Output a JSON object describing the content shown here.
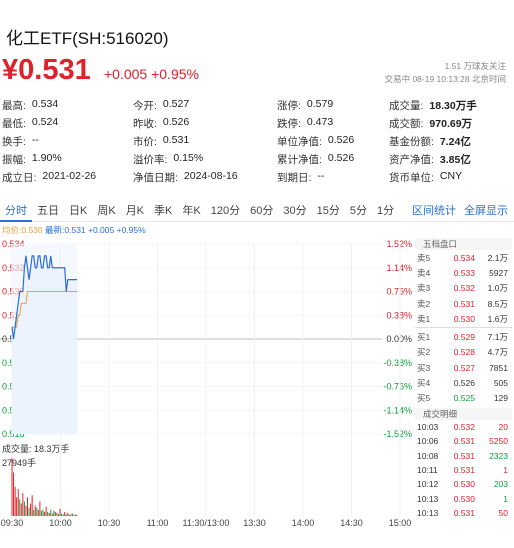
{
  "header": {
    "title": "化工ETF(SH:516020)",
    "price": "¥0.531",
    "change": "+0.005 +0.95%",
    "follow_line1": "1.51 万球友关注",
    "follow_line2": "交易中 08-19 10:13:28 北京时间"
  },
  "quote": [
    [
      {
        "label": "最高:",
        "value": "0.534",
        "tone": "red"
      },
      {
        "label": "今开:",
        "value": "0.527",
        "tone": "red"
      },
      {
        "label": "涨停:",
        "value": "0.579",
        "tone": "red"
      },
      {
        "label": "成交量:",
        "value": "18.30万手",
        "tone": "bold"
      }
    ],
    [
      {
        "label": "最低:",
        "value": "0.524",
        "tone": "green"
      },
      {
        "label": "昨收:",
        "value": "0.526",
        "tone": ""
      },
      {
        "label": "跌停:",
        "value": "0.473",
        "tone": "green"
      },
      {
        "label": "成交额:",
        "value": "970.69万",
        "tone": "bold"
      }
    ],
    [
      {
        "label": "换手:",
        "value": "--",
        "tone": ""
      },
      {
        "label": "市价:",
        "value": "0.531",
        "tone": ""
      },
      {
        "label": "单位净值:",
        "value": "0.526",
        "tone": ""
      },
      {
        "label": "基金份额:",
        "value": "7.24亿",
        "tone": "bold"
      }
    ],
    [
      {
        "label": "振幅:",
        "value": "1.90%",
        "tone": ""
      },
      {
        "label": "溢价率:",
        "value": "0.15%",
        "tone": ""
      },
      {
        "label": "累计净值:",
        "value": "0.526",
        "tone": ""
      },
      {
        "label": "资产净值:",
        "value": "3.85亿",
        "tone": "bold"
      }
    ],
    [
      {
        "label": "成立日:",
        "value": "2021-02-26",
        "tone": ""
      },
      {
        "label": "净值日期:",
        "value": "2024-08-16",
        "tone": ""
      },
      {
        "label": "到期日:",
        "value": "--",
        "tone": ""
      },
      {
        "label": "货币单位:",
        "value": "CNY",
        "tone": ""
      }
    ]
  ],
  "tabs": [
    "分时",
    "五日",
    "日K",
    "周K",
    "月K",
    "季K",
    "年K",
    "120分",
    "60分",
    "30分",
    "15分",
    "5分",
    "1分"
  ],
  "tab_links": [
    "区间统计",
    "全屏显示"
  ],
  "legend": {
    "avg": "均价:0.530",
    "latest": "最新:0.531 +0.005 +0.95%"
  },
  "chart_data": {
    "type": "line",
    "title": "",
    "y_price_ticks": [
      "0.534",
      "0.532",
      "0.530",
      "0.528",
      "0.526",
      "0.524",
      "0.522",
      "0.520",
      "0.518"
    ],
    "y_pct_ticks": [
      "1.52%",
      "1.14%",
      "0.76%",
      "0.38%",
      "0.00%",
      "-0.38%",
      "-0.76%",
      "-1.14%",
      "-1.52%"
    ],
    "x_ticks": [
      "09:30",
      "10:00",
      "10:30",
      "11:00",
      "11:30/13:00",
      "13:30",
      "14:00",
      "14:30",
      "15:00"
    ],
    "ylim": [
      0.518,
      0.534
    ],
    "prev_close": 0.526,
    "price": [
      0.527,
      0.526,
      0.527,
      0.528,
      0.529,
      0.53,
      0.53,
      0.53,
      0.532,
      0.533,
      0.532,
      0.531,
      0.532,
      0.533,
      0.533,
      0.532,
      0.532,
      0.533,
      0.533,
      0.532,
      0.532,
      0.533,
      0.533,
      0.532,
      0.532,
      0.533,
      0.532,
      0.532,
      0.532,
      0.532,
      0.532,
      0.532,
      0.532,
      0.532,
      0.532,
      0.53,
      0.531,
      0.531,
      0.531,
      0.531,
      0.531,
      0.531,
      0.531
    ],
    "avg": [
      0.527,
      0.527,
      0.527,
      0.527,
      0.528,
      0.528,
      0.529,
      0.529,
      0.529,
      0.529,
      0.53,
      0.53,
      0.53,
      0.53,
      0.53,
      0.53,
      0.53,
      0.53,
      0.53,
      0.53,
      0.53,
      0.53,
      0.53,
      0.53,
      0.53,
      0.53,
      0.53,
      0.53,
      0.53,
      0.53,
      0.53,
      0.53,
      0.53,
      0.53,
      0.53,
      0.53,
      0.53,
      0.53,
      0.53,
      0.53,
      0.53,
      0.53,
      0.53
    ],
    "volume_label": "成交量: 18.3万手",
    "volume_max_label": "27949手",
    "volume_max": 27949,
    "volume": [
      27949,
      21000,
      14000,
      9000,
      13000,
      8000,
      6000,
      11000,
      7000,
      5000,
      9000,
      4000,
      6000,
      10000,
      3000,
      5000,
      4000,
      3000,
      7000,
      2500,
      3000,
      2000,
      4500,
      2000,
      1500,
      3000,
      1200,
      2500,
      2000,
      1500,
      900,
      3500,
      1200,
      800,
      2000,
      800,
      1500,
      600,
      900,
      1200,
      500,
      700,
      400
    ],
    "volume_up": [
      1,
      1,
      1,
      1,
      1,
      0,
      1,
      1,
      0,
      1,
      1,
      0,
      1,
      1,
      0,
      1,
      0,
      1,
      1,
      0,
      0,
      1,
      1,
      0,
      1,
      0,
      0,
      1,
      0,
      1,
      0,
      1,
      0,
      0,
      1,
      0,
      1,
      0,
      1,
      0,
      0,
      1,
      1
    ]
  },
  "order_book": {
    "title": "五档盘口",
    "asks": [
      [
        "卖5",
        "0.534",
        "2.1万"
      ],
      [
        "卖4",
        "0.533",
        "5927"
      ],
      [
        "卖3",
        "0.532",
        "1.0万"
      ],
      [
        "卖2",
        "0.531",
        "8.5万"
      ],
      [
        "卖1",
        "0.530",
        "1.6万"
      ]
    ],
    "bids": [
      [
        "买1",
        "0.529",
        "7.1万"
      ],
      [
        "买2",
        "0.528",
        "4.7万"
      ],
      [
        "买3",
        "0.527",
        "7851"
      ],
      [
        "买4",
        "0.526",
        "505"
      ],
      [
        "买5",
        "0.525",
        "129"
      ]
    ]
  },
  "trades": {
    "title": "成交明细",
    "rows": [
      [
        "10:03",
        "0.532",
        "20",
        "red"
      ],
      [
        "10:06",
        "0.531",
        "5250",
        "red"
      ],
      [
        "10:08",
        "0.531",
        "2323",
        "green"
      ],
      [
        "10:11",
        "0.531",
        "1",
        "red"
      ],
      [
        "10:12",
        "0.530",
        "203",
        "green"
      ],
      [
        "10:13",
        "0.530",
        "1",
        "green"
      ],
      [
        "10:13",
        "0.531",
        "50",
        "red"
      ]
    ]
  }
}
